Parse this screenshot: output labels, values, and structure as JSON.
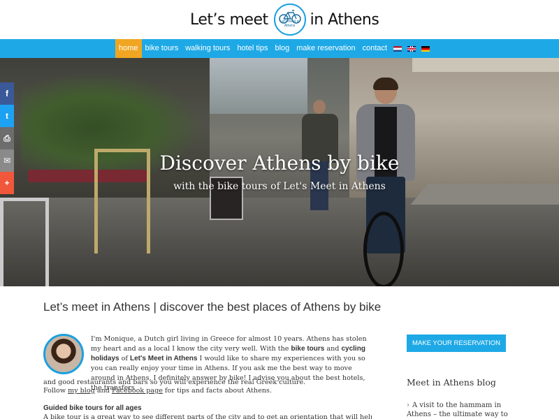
{
  "logo": {
    "text_left": "Let’s meet",
    "badge_text": "Let's meet in Athens",
    "text_right": "in Athens",
    "accent": "#1aa0e0"
  },
  "nav": {
    "items": [
      {
        "label": "home",
        "active": true
      },
      {
        "label": "bike tours"
      },
      {
        "label": "walking tours"
      },
      {
        "label": "hotel tips"
      },
      {
        "label": "blog"
      },
      {
        "label": "make reservation"
      },
      {
        "label": "contact"
      }
    ],
    "flags": [
      "flag-nl-icon",
      "flag-uk-icon",
      "flag-de-icon"
    ],
    "background": "#1ea9e6",
    "active_color": "#f0a622"
  },
  "social": {
    "buttons": [
      {
        "icon": "facebook-icon",
        "glyph": "f"
      },
      {
        "icon": "twitter-icon",
        "glyph": "t"
      },
      {
        "icon": "print-icon",
        "glyph": "⎙"
      },
      {
        "icon": "email-icon",
        "glyph": "✉"
      },
      {
        "icon": "plus-icon",
        "glyph": "+"
      }
    ]
  },
  "hero": {
    "title": "Discover Athens by bike",
    "subtitle": "with the bike tours of Let's Meet in Athens"
  },
  "content": {
    "heading": "Let’s meet in Athens | discover the best places of Athens by bike",
    "intro_1": "I'm Monique, a Dutch girl living in Greece for almost 10 years. Athens has stolen my heart and as a local I know the city very well. With the ",
    "intro_bold_1": "bike tours",
    "intro_2": " and ",
    "intro_bold_2": "cycling holidays",
    "intro_3": " of ",
    "intro_bold_3": "Let's Meet in Athens",
    "intro_4": " I would like to share my experiences with you so you can really enjoy your time in Athens. If you ask me the best way to move around in Athens, I definitely answer by bike! I advise you about the best hotels, the transfers",
    "intro_5": "and good restaurants and bars so you will experience the real Greek culture.",
    "follow_1": "Follow ",
    "follow_link_1": "my blog",
    "follow_2": " and ",
    "follow_link_2": "Facebook page",
    "follow_3": " for tips and facts about Athens.",
    "sub_heading": "Guided bike tours for all ages",
    "body_line": "A bike tour is a great way to see different parts of the city and to get an orientation that will help you"
  },
  "sidebar": {
    "reserve_button": "MAKE YOUR RESERVATION",
    "blog_title": "Meet in Athens blog",
    "blog_item_chevron": "›",
    "blog_item": "A visit to the hammam in Athens – the ultimate way to"
  }
}
